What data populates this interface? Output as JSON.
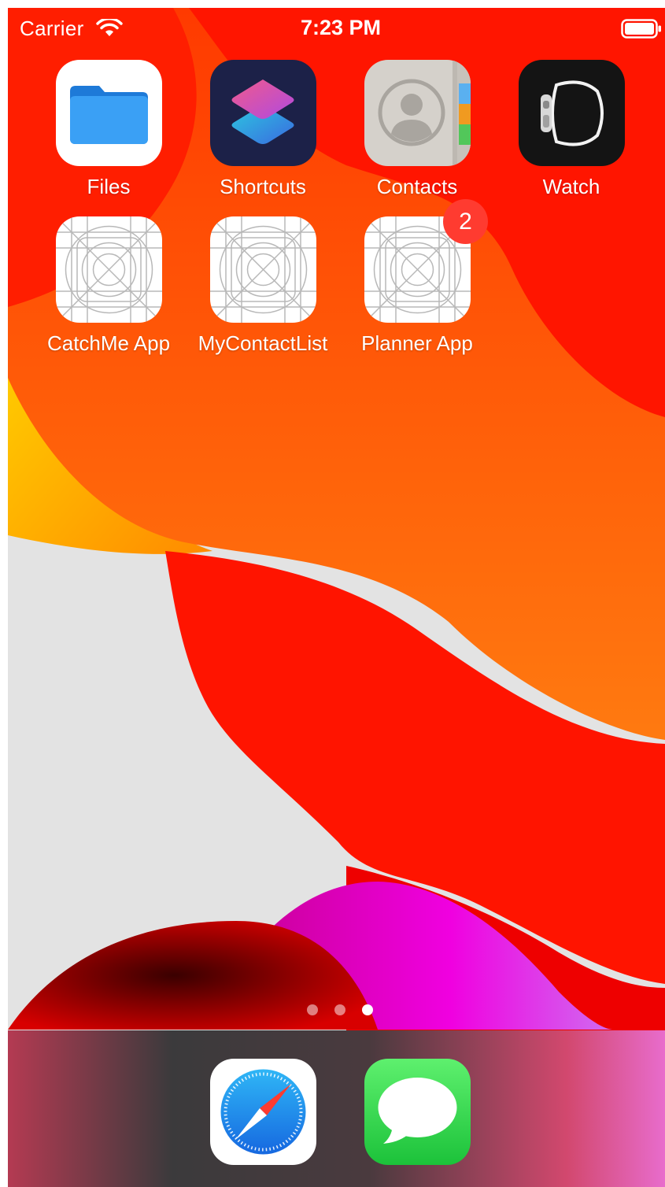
{
  "status_bar": {
    "carrier": "Carrier",
    "time": "7:23 PM",
    "wifi_icon": "wifi-icon",
    "battery_icon": "battery-full-icon"
  },
  "home_screen": {
    "apps": [
      {
        "label": "Files",
        "icon": "files-folder-icon"
      },
      {
        "label": "Shortcuts",
        "icon": "shortcuts-icon"
      },
      {
        "label": "Contacts",
        "icon": "contacts-icon"
      },
      {
        "label": "Watch",
        "icon": "watch-icon"
      },
      {
        "label": "CatchMe App",
        "icon": "placeholder-app-icon"
      },
      {
        "label": "MyContactList",
        "icon": "placeholder-app-icon"
      },
      {
        "label": "Planner App",
        "icon": "placeholder-app-icon",
        "badge": "2"
      }
    ],
    "page_indicator": {
      "pages": 3,
      "current": 3
    }
  },
  "dock": {
    "apps": [
      {
        "label": "Safari",
        "icon": "safari-compass-icon"
      },
      {
        "label": "Messages",
        "icon": "messages-bubble-icon"
      }
    ]
  },
  "colors": {
    "wallpaper_red": "#ff1a00",
    "wallpaper_orange": "#ff6a00",
    "wallpaper_yellow": "#ffd000",
    "badge_red": "#ff3b30",
    "messages_green": "#34c759",
    "safari_blue": "#1e88f0"
  }
}
